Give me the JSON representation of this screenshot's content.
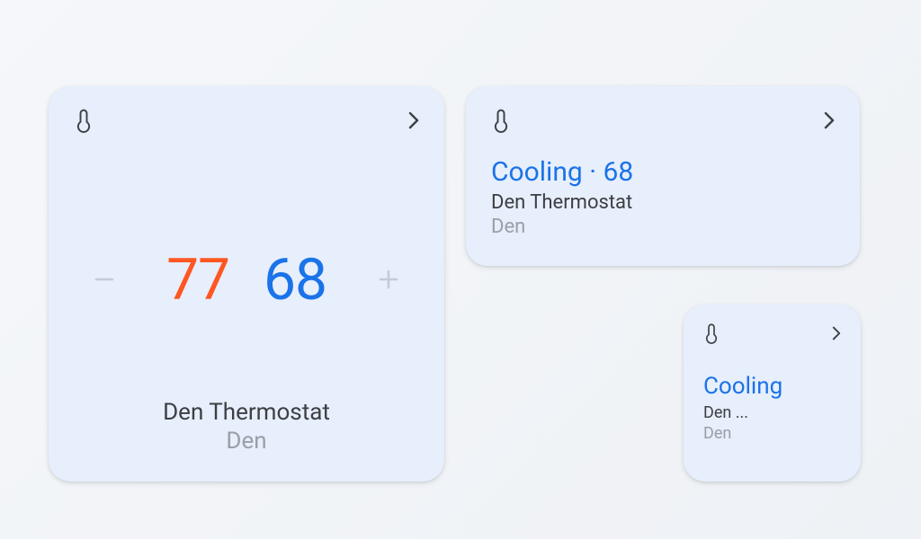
{
  "large_card": {
    "heat_setpoint": "77",
    "cool_setpoint": "68",
    "device_name": "Den Thermostat",
    "room": "Den"
  },
  "medium_card": {
    "status_mode": "Cooling",
    "status_sep": " · ",
    "status_temp": "68",
    "device_name": "Den Thermostat",
    "room": "Den"
  },
  "small_card": {
    "status_mode": "Cooling",
    "device_name": "Den ...",
    "room": "Den"
  },
  "colors": {
    "card_bg": "#e7eefc",
    "heat": "#ff5722",
    "cool": "#1a73e8",
    "text_primary": "#3c4043",
    "text_secondary": "#9aa0a6"
  }
}
